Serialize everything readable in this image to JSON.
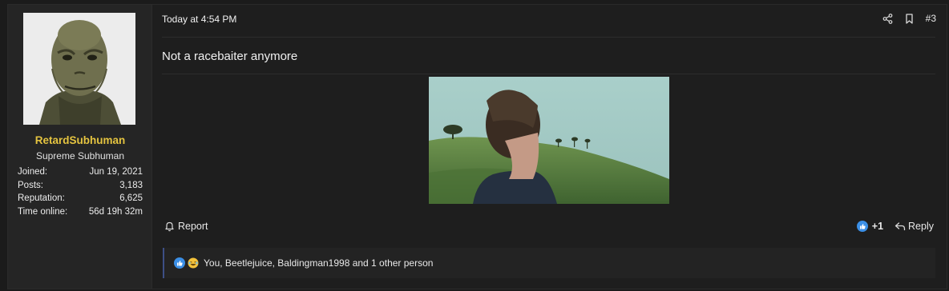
{
  "user": {
    "name": "RetardSubhuman",
    "title": "Supreme Subhuman",
    "stats": [
      {
        "label": "Joined:",
        "value": "Jun 19, 2021"
      },
      {
        "label": "Posts:",
        "value": "3,183"
      },
      {
        "label": "Reputation:",
        "value": "6,625"
      },
      {
        "label": "Time online:",
        "value": "56d 19h 32m"
      }
    ]
  },
  "post": {
    "date": "Today at 4:54 PM",
    "number": "#3",
    "text": "Not a racebaiter anymore"
  },
  "actions": {
    "report": "Report",
    "score": "+1",
    "reply": "Reply"
  },
  "reactions": {
    "text": "You, Beetlejuice, Baldingman1998 and 1 other person"
  },
  "colors": {
    "username": "#e5c440",
    "reaction_border": "#3d4f86",
    "like_blue": "#3b8fe6"
  },
  "icons": [
    "share-icon",
    "bookmark-icon",
    "bell-icon",
    "like-icon",
    "reply-icon",
    "laugh-icon"
  ]
}
